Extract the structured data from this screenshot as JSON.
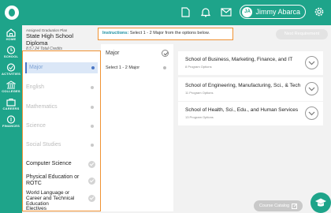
{
  "user": {
    "initials": "JA",
    "name": "Jimmy Abarca"
  },
  "nav": [
    {
      "label": "HOME",
      "icon": "home-icon"
    },
    {
      "label": "SCHOOL",
      "icon": "school-icon"
    },
    {
      "label": "ACTIVITIES",
      "icon": "activities-icon"
    },
    {
      "label": "COLLEGES",
      "icon": "colleges-icon"
    },
    {
      "label": "CAREERS",
      "icon": "careers-icon"
    },
    {
      "label": "FINANCES",
      "icon": "finances-icon"
    }
  ],
  "plan": {
    "assigned_label": "Assigned Graduation Plan",
    "title": "State High School Diploma",
    "credits": "8.5 / 24 Total Credits"
  },
  "instructions": {
    "prefix": "Instructions:",
    "text": " Select 1 - 2 Major from the options below."
  },
  "next_button": "Next Requirement",
  "subject_areas": [
    {
      "label": "Major",
      "state": "selected"
    },
    {
      "label": "English",
      "state": "incomplete"
    },
    {
      "label": "Mathematics",
      "state": "incomplete"
    },
    {
      "label": "Science",
      "state": "incomplete"
    },
    {
      "label": "Social Studies",
      "state": "incomplete"
    },
    {
      "label": "Computer Science",
      "state": "complete"
    },
    {
      "label": "Physical Education or ROTC",
      "state": "complete"
    },
    {
      "label": "World Language or Career and Technical Education",
      "state": "complete"
    },
    {
      "label": "Electives",
      "state": "complete"
    }
  ],
  "major_panel": {
    "heading": "Major",
    "select_label": "Select 1 - 2 Major"
  },
  "schools": [
    {
      "name": "School of Business, Marketing, Finance, and IT",
      "count": "8 Program Options"
    },
    {
      "name": "School of Engineering, Manufacturing, Sci., & Tech",
      "count": "11 Program Options"
    },
    {
      "name": "School of Health, Sci., Edu., and Human Services",
      "count": "13 Program Options"
    }
  ],
  "course_catalog": "Course Catalog",
  "colors": {
    "brand": "#1ea48a",
    "highlight": "#f09233",
    "selected": "#4a76c4"
  }
}
